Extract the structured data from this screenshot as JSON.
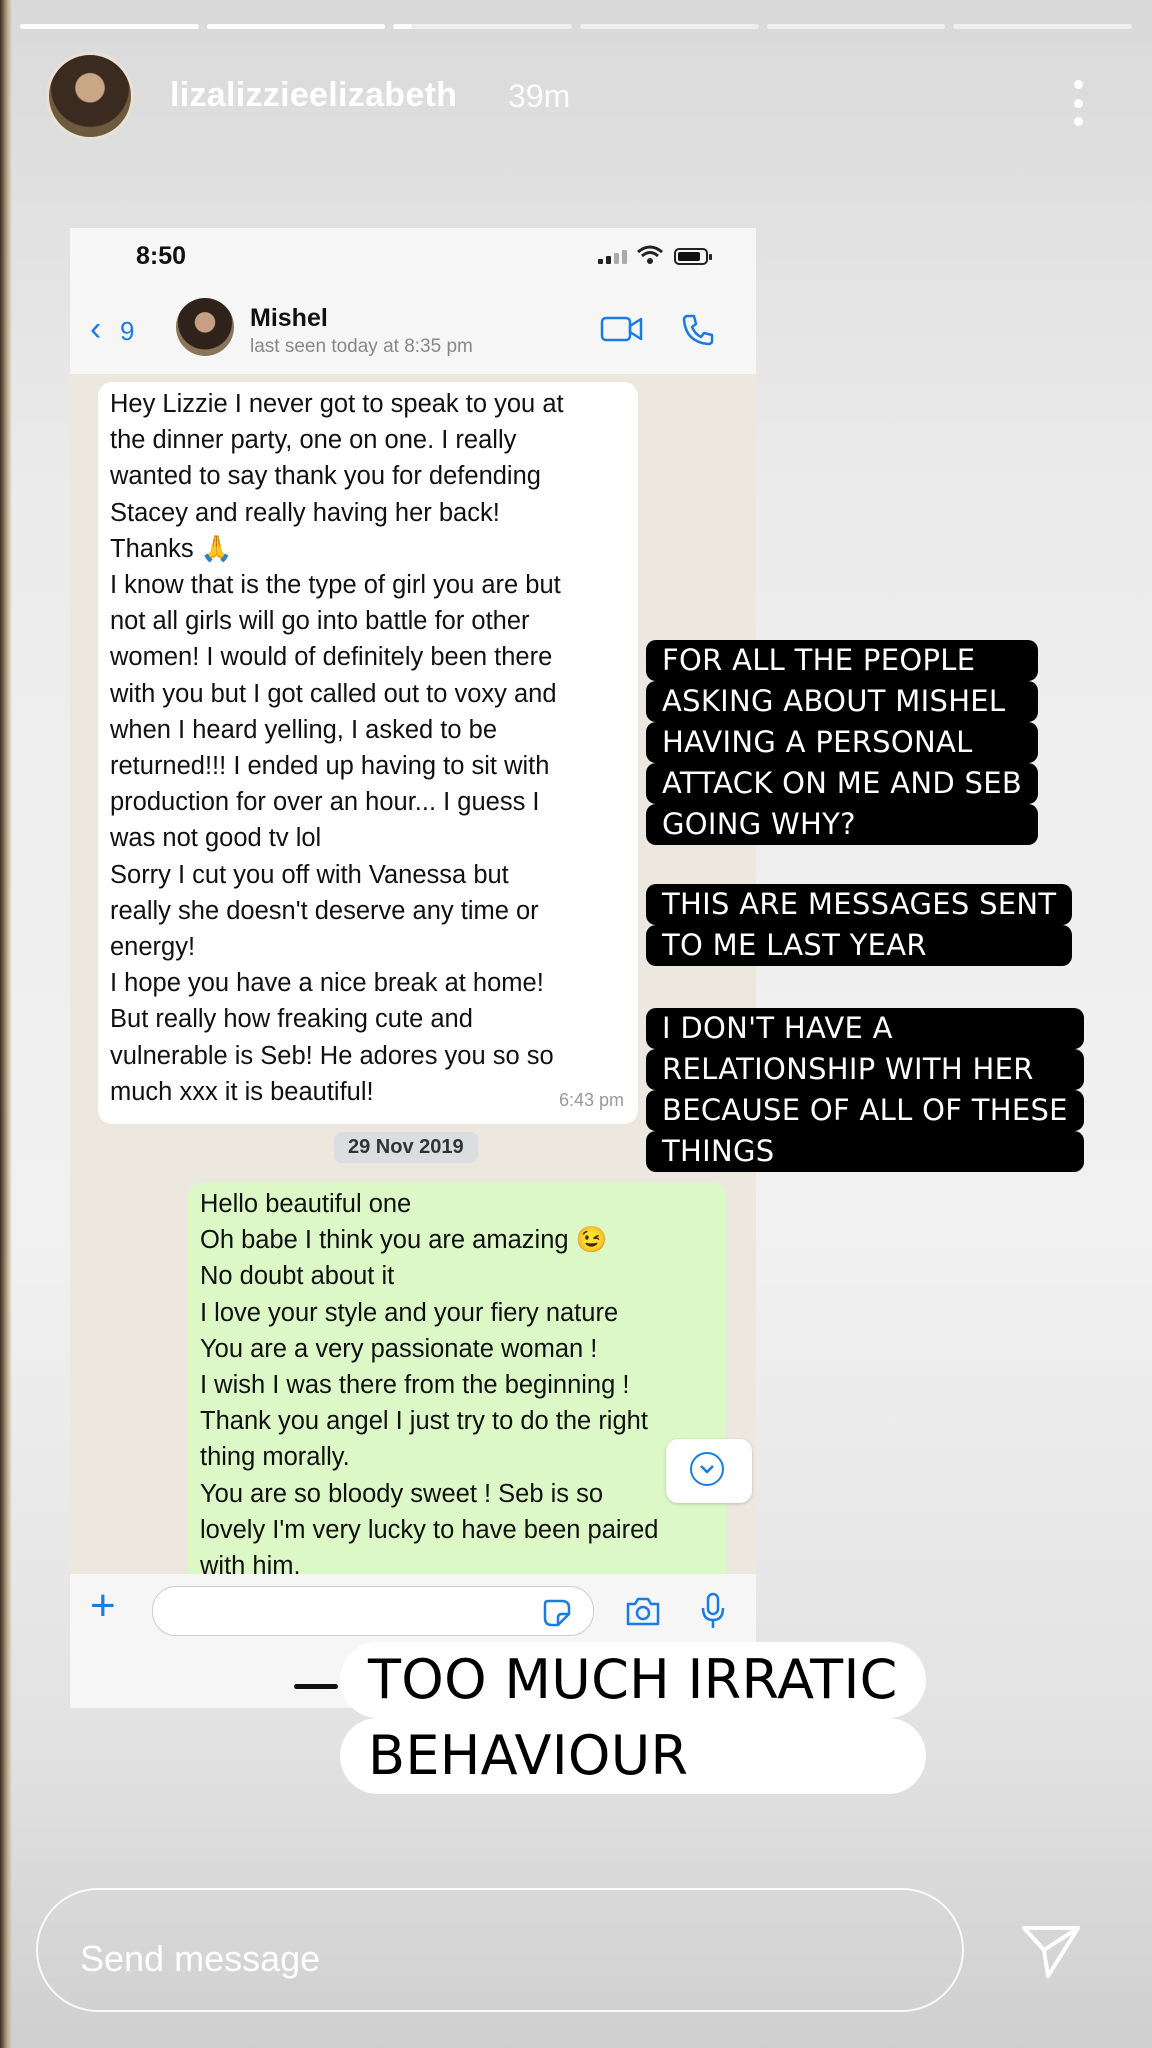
{
  "story": {
    "progress": [
      1,
      1,
      0.1,
      0,
      0,
      0
    ],
    "username": "lizalizzieelizabeth",
    "time": "39m",
    "more_icon": "more-vertical-icon"
  },
  "screenshot": {
    "status_time": "8:50",
    "back_count": "9",
    "contact_name": "Mishel",
    "last_seen": "last seen today at 8:35 pm",
    "incoming": {
      "lines": [
        "Hey Lizzie I never got to speak to you at",
        "the dinner party, one on one. I really",
        "wanted to say thank you for defending",
        "Stacey and really having her back!",
        "Thanks 🙏",
        "I know that is the type of girl you are but",
        "not all girls will go into battle for other",
        "women! I would of definitely been there",
        "with you but I got called out to voxy and",
        "when I heard yelling, I asked to be",
        "returned!!! I ended up having to sit with",
        "production for over an hour... I guess I",
        "was not good tv lol",
        "Sorry I cut you off with Vanessa but",
        "really she doesn't deserve any time or",
        "energy!",
        "I hope you have a nice break at home!",
        "But really how freaking cute and",
        "vulnerable is Seb! He adores you so so",
        "much xxx it is beautiful!"
      ],
      "time": "6:43 pm"
    },
    "date_chip": "29 Nov 2019",
    "outgoing": {
      "lines": [
        "Hello beautiful one",
        "Oh babe I think you are amazing 😉",
        "No doubt about it",
        "I love your style and your fiery nature",
        "You are a very passionate woman !",
        "I wish I was there from the beginning !",
        "Thank you angel I just try to do the right",
        "thing morally.",
        "You are so bloody sweet ! Seb is so",
        "lovely I'm very lucky to have been paired",
        "with him."
      ]
    }
  },
  "captions": {
    "block1": [
      "FOR ALL THE PEOPLE",
      "ASKING ABOUT MISHEL",
      "HAVING A PERSONAL",
      "ATTACK ON ME AND SEB",
      "GOING WHY?"
    ],
    "block2": [
      "THIS ARE MESSAGES SENT",
      "TO ME LAST YEAR"
    ],
    "block3": [
      "I DON'T HAVE A",
      "RELATIONSHIP WITH HER",
      "BECAUSE OF ALL OF THESE",
      "THINGS"
    ],
    "big": [
      "TOO MUCH IRRATIC",
      "BEHAVIOUR"
    ]
  },
  "footer": {
    "send_placeholder": "Send message",
    "send_icon": "paper-plane-icon"
  }
}
